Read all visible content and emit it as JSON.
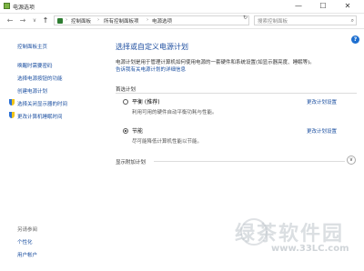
{
  "window": {
    "title": "电源选项",
    "minimize": "—",
    "maximize": "☐",
    "close": "✕"
  },
  "address": {
    "back": "←",
    "forward": "→",
    "dropdown": "∨",
    "up": "↑",
    "crumbs": [
      "控制面板",
      "所有控制面板项",
      "电源选项"
    ],
    "separator": "›",
    "refresh": "↻",
    "search_placeholder": "搜索控制面板",
    "search_icon": "⌕"
  },
  "help": "?",
  "sidebar": {
    "links": [
      "控制面板主页",
      "唤醒时需要密码",
      "选择电源按钮的功能",
      "创建电源计划",
      "选择关闭显示器的时间",
      "更改计算机睡眠时间"
    ],
    "see_also": "另请参阅",
    "bottom_links": [
      "个性化",
      "用户帐户"
    ]
  },
  "main": {
    "heading": "选择或自定义电源计划",
    "description": "电源计划是用于管理计算机如何使用电源的一套硬件和系统设置(如显示器亮度、睡眠等)。",
    "link": "告诉我有关电源计划的详细信息",
    "section": "首选计划",
    "plans": [
      {
        "name": "平衡 (推荐)",
        "desc": "利用可用的硬件自动平衡功耗与性能。",
        "change": "更改计划设置",
        "selected": false
      },
      {
        "name": "节能",
        "desc": "尽可能降低计算机性能以节能。",
        "change": "更改计划设置",
        "selected": true
      }
    ],
    "extra": "显示附加计划",
    "chevron": "∨"
  },
  "watermark": {
    "text": "绿茶软件园",
    "url": "www.33LC.com"
  }
}
